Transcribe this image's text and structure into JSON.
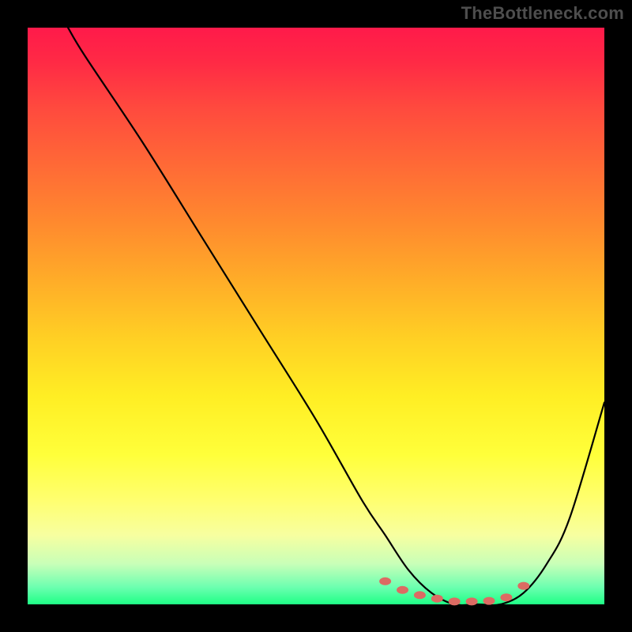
{
  "watermark": "TheBottleneck.com",
  "colors": {
    "background": "#000000",
    "gradient_top": "#ff1a4a",
    "gradient_bottom": "#1eff86",
    "curve_stroke": "#000000",
    "marker_fill": "#dc6b63"
  },
  "chart_data": {
    "type": "line",
    "title": "",
    "xlabel": "",
    "ylabel": "",
    "xlim": [
      0,
      100
    ],
    "ylim": [
      0,
      100
    ],
    "grid": false,
    "legend": false,
    "series": [
      {
        "name": "curve",
        "x": [
          7,
          10,
          20,
          30,
          40,
          50,
          58,
          62,
          66,
          70,
          74,
          78,
          82,
          86,
          90,
          94,
          100
        ],
        "values": [
          100,
          95,
          80,
          64,
          48,
          32,
          18,
          12,
          6,
          2,
          0,
          0,
          0,
          2,
          7,
          15,
          35
        ]
      }
    ],
    "markers": {
      "name": "highlight-points",
      "x": [
        62,
        65,
        68,
        71,
        74,
        77,
        80,
        83,
        86
      ],
      "values": [
        4.0,
        2.5,
        1.6,
        1.0,
        0.5,
        0.5,
        0.6,
        1.2,
        3.2
      ]
    }
  }
}
